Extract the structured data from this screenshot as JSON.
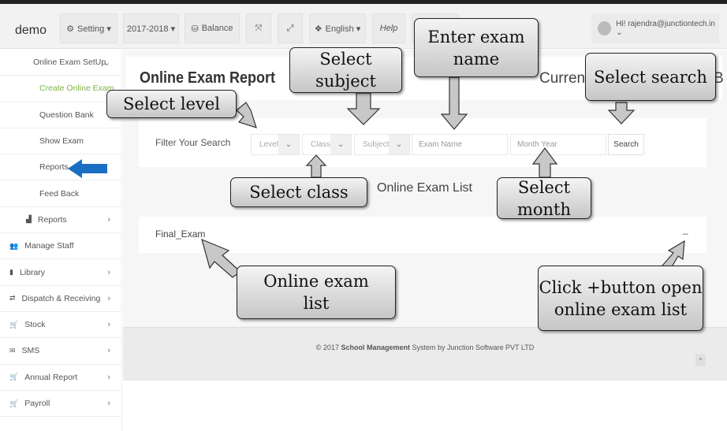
{
  "header": {
    "brand": "demo",
    "setting": "Setting ▾",
    "year": "2017-2018 ▾",
    "balance": "Balance",
    "expand": "⤧",
    "fullscreen": "⤢",
    "language": "English ▾",
    "help": "Help",
    "user": "Hi! rajendra@junctiontech.in ⌄"
  },
  "sidebar": {
    "items": [
      {
        "label": "Online Exam SetUp",
        "chev": "⌄",
        "indent": 42,
        "color": "#555"
      },
      {
        "label": "Create Online Exam",
        "indent": 50,
        "color": "#7cb342"
      },
      {
        "label": "Question Bank",
        "indent": 50
      },
      {
        "label": "Show Exam",
        "indent": 50
      },
      {
        "label": "Reports",
        "indent": 50
      },
      {
        "label": "Feed Back",
        "indent": 50
      },
      {
        "label": "Reports",
        "icon": "▟",
        "chev": "›",
        "indent": 33
      },
      {
        "label": "Manage Staff",
        "icon": "👥",
        "chev": "",
        "indent": 12
      },
      {
        "label": "Library",
        "icon": "▮",
        "chev": "›",
        "indent": 12
      },
      {
        "label": "Dispatch & Receiving",
        "icon": "⇄",
        "chev": "›",
        "indent": 12
      },
      {
        "label": "Stock",
        "icon": "🛒",
        "chev": "›",
        "indent": 12
      },
      {
        "label": "SMS",
        "icon": "✉",
        "chev": "›",
        "indent": 12
      },
      {
        "label": "Annual Report",
        "icon": "🛒",
        "chev": "›",
        "indent": 12
      },
      {
        "label": "Payroll",
        "icon": "🛒",
        "chev": "›",
        "indent": 12
      }
    ]
  },
  "main": {
    "title": "Online Exam Report",
    "current": "Current",
    "current_tail": "B",
    "filter_label": "Filter Your Search",
    "level": "Level",
    "class": "Class",
    "subject": "Subject",
    "exam_name_placeholder": "Exam Name",
    "month_year_placeholder": "Month Year",
    "search": "Search",
    "list_title": "Online Exam List",
    "exam": "Final_Exam",
    "toggle": "–"
  },
  "footer": {
    "prefix": "© 2017 ",
    "bold": "School Management",
    "suffix": " System by Junction Software PVT LTD",
    "up": "^"
  },
  "callouts": {
    "level": "Select level",
    "subject": "Select subject",
    "exam_name": "Enter exam name",
    "search": "Select search",
    "class": "Select class",
    "month": "Select month",
    "list": "Online exam list",
    "plus": "Click +button open online exam list"
  },
  "colors": {
    "accent_green": "#7cb342",
    "pointer_blue": "#1a6fc4"
  }
}
